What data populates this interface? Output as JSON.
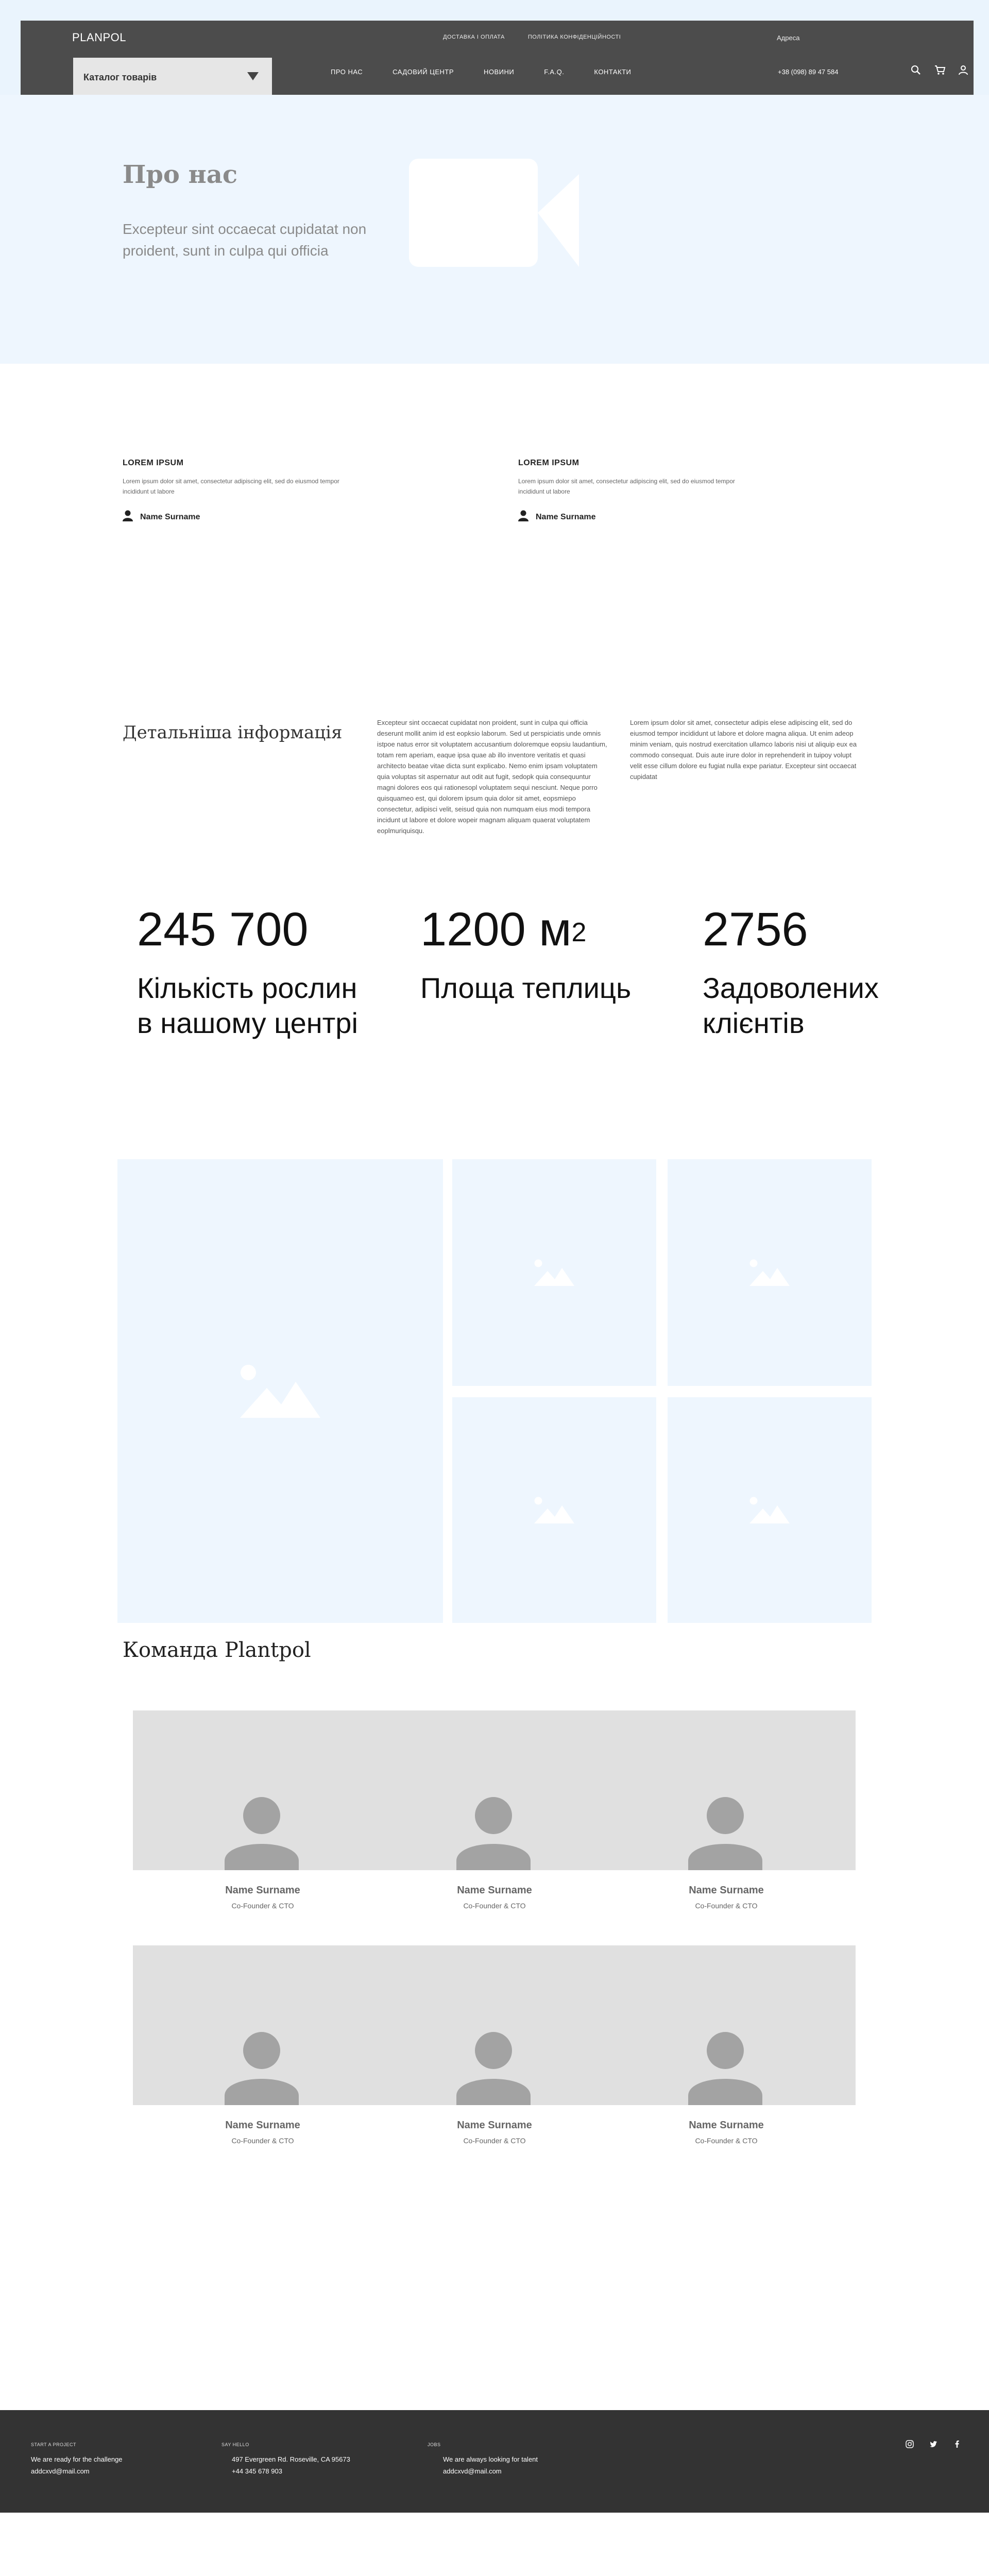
{
  "header": {
    "logo": "PLANPOL",
    "top_links": [
      "ДОСТАВКА І ОПЛАТА",
      "ПОЛІТИКА КОНФІДЕНЦІЙНОСТІ"
    ],
    "addresses": "Адреса",
    "catalog_label": "Каталог товарів",
    "nav": [
      "ПРО НАС",
      "САДОВИЙ ЦЕНТР",
      "НОВИНИ",
      "F.A.Q.",
      "КОНТАКТИ"
    ],
    "phone": "+38 (098) 89 47 584",
    "icons": [
      "search-icon",
      "cart-icon",
      "user-icon"
    ]
  },
  "hero": {
    "title": "Про нас",
    "text": "Excepteur sint occaecat cupidatat non proident, sunt in culpa qui officia",
    "video_icon": "video-camera-icon"
  },
  "lorem_blocks": [
    {
      "title": "LOREM IPSUM",
      "text": "Lorem ipsum dolor sit amet, consectetur adipiscing elit, sed do eiusmod tempor incididunt ut labore",
      "author": "Name Surname"
    },
    {
      "title": "LOREM IPSUM",
      "text": "Lorem ipsum dolor sit amet, consectetur adipiscing elit, sed do eiusmod tempor incididunt ut labore",
      "author": "Name Surname"
    }
  ],
  "details": {
    "title": "Детальніша інформація",
    "col1": "Excepteur sint occaecat cupidatat non proident, sunt in culpa qui officia deserunt mollit anim id est eopksio laborum. Sed ut perspiciatis unde omnis istpoe natus error sit voluptatem accusantium doloremque eopsiu laudantium, totam rem aperiam, eaque ipsa quae ab illo inventore veritatis et quasi architecto beatae vitae dicta sunt explicabo. Nemo enim ipsam voluptatem quia voluptas sit aspernatur aut odit aut fugit, sedopk quia consequuntur magni dolores eos qui rationesopl voluptatem sequi nesciunt. Neque porro quisquameo est, qui dolorem ipsum quia dolor sit amet, eopsmiepo consectetur, adipisci velit, seisud quia non numquam eius modi tempora incidunt ut labore et dolore wopeir magnam aliquam quaerat voluptatem eoplmuriquisqu.",
    "col2": "Lorem ipsum dolor sit amet, consectetur adipis elese adipiscing elit, sed do eiusmod tempor incididunt ut labore et dolore magna aliqua. Ut enim adeop minim veniam, quis nostrud exercitation ullamco laboris nisi ut aliquip eux ea commodo consequat. Duis aute irure dolor in reprehenderit in tuipoy volupt velit esse cillum dolore eu fugiat nulla expe pariatur. Excepteur sint occaecat cupidatat"
  },
  "stats": [
    {
      "number": "245 700",
      "unit_sup": "",
      "label_line1": "Кількість рослин",
      "label_line2": "в нашому центрі"
    },
    {
      "number": "1200 м",
      "unit_sup": "2",
      "label_line1": "Площа теплиць",
      "label_line2": ""
    },
    {
      "number": "2756",
      "unit_sup": "",
      "label_line1": "Задоволених",
      "label_line2": "клієнтів"
    }
  ],
  "gallery": {
    "icon": "image-placeholder-icon",
    "count": 5
  },
  "team": {
    "title": "Команда Plantpol",
    "members": [
      {
        "name": "Name Surname",
        "role": "Co-Founder & CTO"
      },
      {
        "name": "Name Surname",
        "role": "Co-Founder & CTO"
      },
      {
        "name": "Name Surname",
        "role": "Co-Founder & CTO"
      },
      {
        "name": "Name Surname",
        "role": "Co-Founder & CTO"
      },
      {
        "name": "Name Surname",
        "role": "Co-Founder & CTO"
      },
      {
        "name": "Name Surname",
        "role": "Co-Founder & CTO"
      }
    ]
  },
  "footer": {
    "columns": [
      {
        "head": "START A PROJECT",
        "lines": [
          "We are ready for the challenge",
          "addcxvd@mail.com"
        ]
      },
      {
        "head": "SAY HELLO",
        "lines": [
          "497 Evergreen Rd. Roseville, CA 95673",
          "+44 345 678 903"
        ]
      },
      {
        "head": "JOBS",
        "lines": [
          "We are always looking for talent",
          "addcxvd@mail.com"
        ]
      }
    ],
    "social": [
      "instagram-icon",
      "twitter-icon",
      "facebook-icon"
    ]
  },
  "colors": {
    "header_bar": "#4c4c4c",
    "hero_bg": "#eef6fe",
    "placeholder_gray": "#e0e0e0",
    "footer_bg": "#333333"
  }
}
